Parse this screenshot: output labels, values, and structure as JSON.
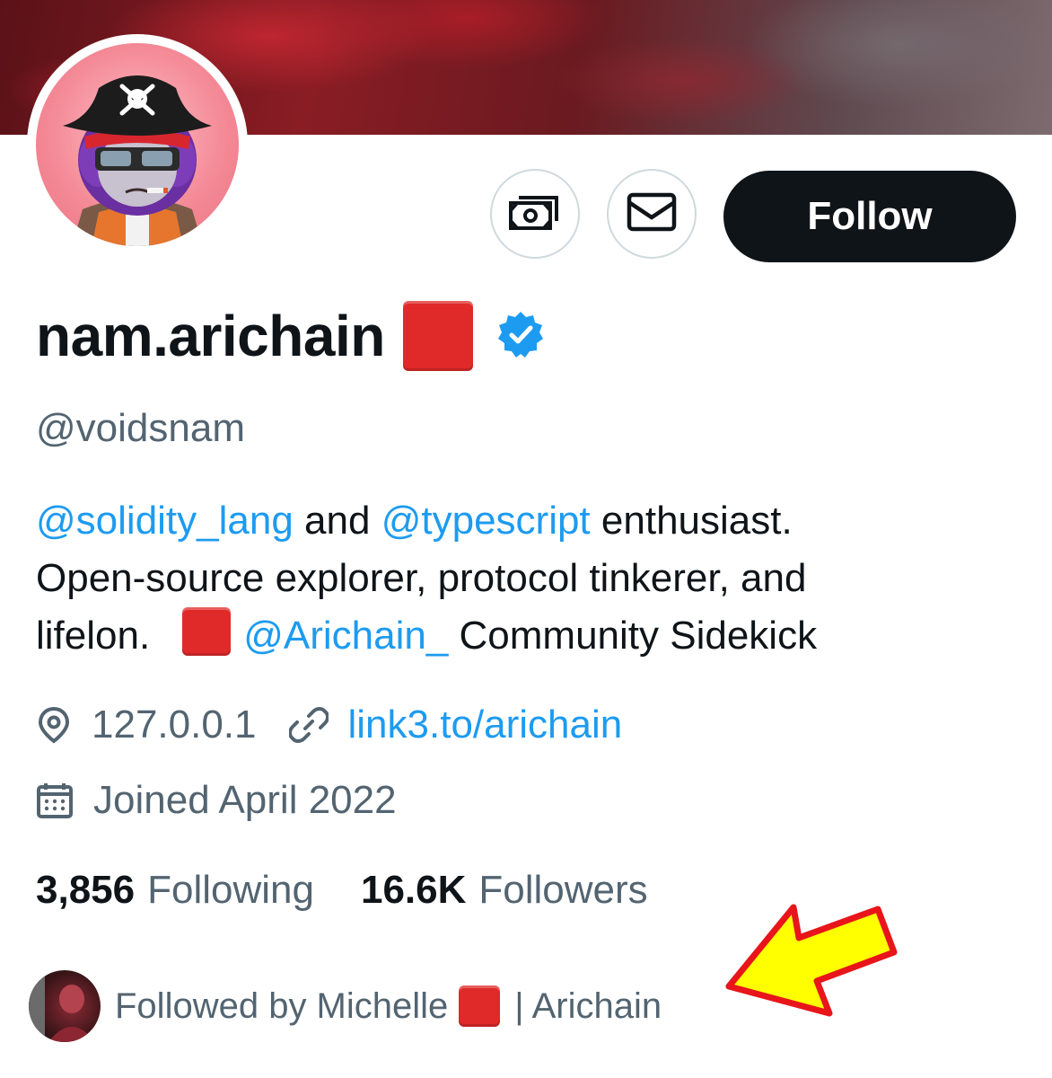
{
  "profile": {
    "display_name": "nam.arichain",
    "handle": "@voidsnam",
    "verified": true,
    "badge_emoji": "red-square",
    "follow_label": "Follow",
    "tip_button_icon": "money-icon",
    "message_button_icon": "mail-icon"
  },
  "bio": {
    "line1": {
      "mention1": "@solidity_lang",
      "text1": " and ",
      "mention2": "@typescript",
      "text2": " enthusiast."
    },
    "line2": "Open-source explorer, protocol tinkerer, and",
    "line3": {
      "text1": "lifelon.",
      "mention": "@Arichain_",
      "text2": " Community Sidekick"
    }
  },
  "meta": {
    "location": "127.0.0.1",
    "website": "link3.to/arichain",
    "joined": "Joined April 2022"
  },
  "stats": {
    "following_count": "3,856",
    "following_label": "Following",
    "followers_count": "16.6K",
    "followers_label": "Followers"
  },
  "followed_by": {
    "prefix": "Followed by Michelle",
    "suffix": "| Arichain"
  },
  "colors": {
    "accent": "#1d9bf0",
    "text_primary": "#0f1419",
    "text_secondary": "#536471",
    "follow_button_bg": "#0f1419",
    "annotation_arrow_fill": "#ffff00",
    "annotation_arrow_stroke": "#e8151b",
    "emoji_red": "#e02a2a"
  }
}
